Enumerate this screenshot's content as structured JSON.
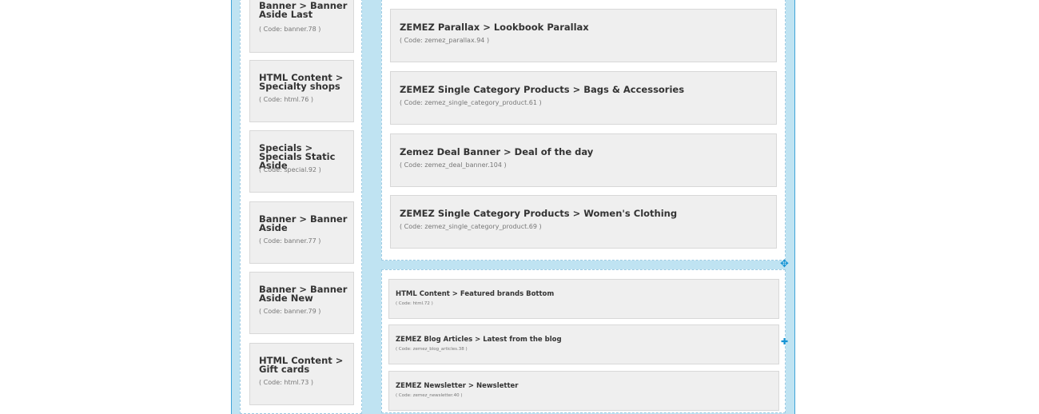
{
  "left_column": [
    {
      "title": "Banner > Banner Aside Last",
      "code": "( Code: banner.78 )"
    },
    {
      "title": "HTML Content > Specialty shops",
      "code": "( Code: html.76 )"
    },
    {
      "title": "Specials > Specials Static Aside",
      "code": "( Code: special.92 )"
    },
    {
      "title": "Banner > Banner Aside",
      "code": "( Code: banner.77 )"
    },
    {
      "title": "Banner > Banner Aside New",
      "code": "( Code: banner.79 )"
    },
    {
      "title": "HTML Content > Gift cards",
      "code": "( Code: html.73 )"
    }
  ],
  "right_column": [
    {
      "title": "ZEMEZ Parallax > Lookbook Parallax",
      "code": "( Code: zemez_parallax.94 )"
    },
    {
      "title": "ZEMEZ Single Category Products > Bags & Accessories",
      "code": "( Code: zemez_single_category_product.61 )"
    },
    {
      "title": "Zemez Deal Banner > Deal of the day",
      "code": "( Code: zemez_deal_banner.104 )"
    },
    {
      "title": "ZEMEZ Single Category Products > Women's Clothing",
      "code": "( Code: zemez_single_category_product.69 )"
    }
  ],
  "bottom_column": [
    {
      "title": "HTML Content > Featured brands Bottom",
      "code": "( Code: html.72 )"
    },
    {
      "title": "ZEMEZ Blog Articles > Latest from the blog",
      "code": "( Code: zemez_blog_articles.38 )"
    },
    {
      "title": "ZEMEZ Newsletter > Newsletter",
      "code": "( Code: zemez_newsletter.40 )"
    }
  ],
  "controls": {
    "move_icon": "✥",
    "add_icon": "✚"
  },
  "colors": {
    "accent": "#1593d4",
    "frame_bg": "#bfe3f2",
    "card_bg": "#efefef"
  }
}
